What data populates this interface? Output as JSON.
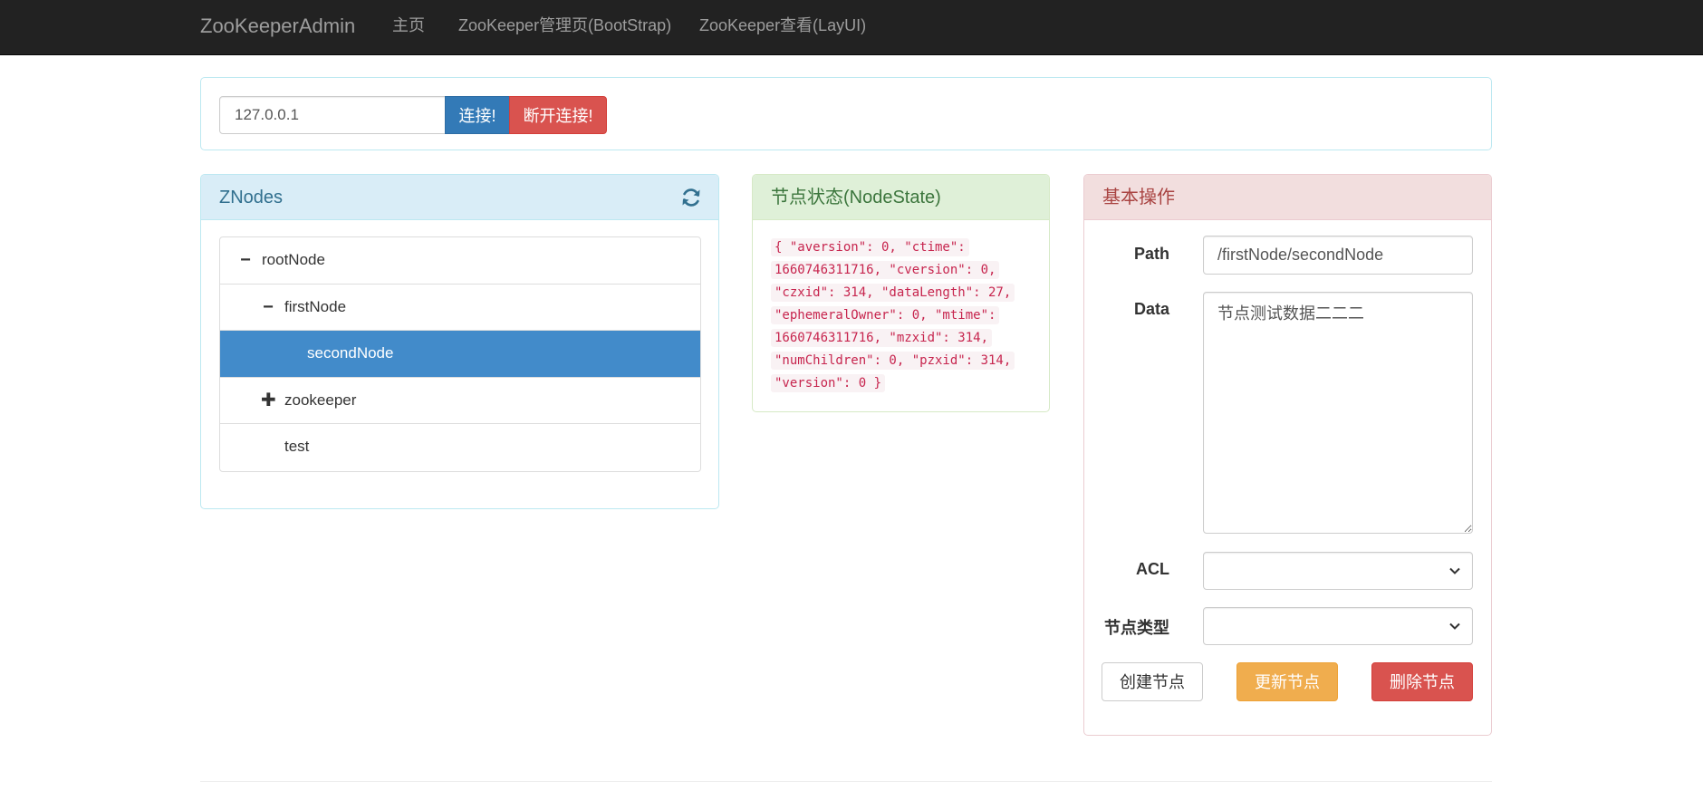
{
  "navbar": {
    "brand": "ZooKeeperAdmin",
    "links": [
      "主页",
      "ZooKeeper管理页(BootStrap)",
      "ZooKeeper查看(LayUI)"
    ]
  },
  "connect": {
    "host_value": "127.0.0.1",
    "connect_label": "连接!",
    "disconnect_label": "断开连接!"
  },
  "znodes": {
    "title": "ZNodes",
    "refresh_icon": "refresh-icon",
    "tree": [
      {
        "label": "rootNode",
        "level": 0,
        "icon": "minus",
        "selected": false
      },
      {
        "label": "firstNode",
        "level": 1,
        "icon": "minus",
        "selected": false
      },
      {
        "label": "secondNode",
        "level": 2,
        "icon": "",
        "selected": true
      },
      {
        "label": "zookeeper",
        "level": 1,
        "icon": "plus",
        "selected": false
      },
      {
        "label": "test",
        "level": 1,
        "icon": "",
        "selected": false
      }
    ]
  },
  "nodestate": {
    "title": "节点状态(NodeState)",
    "json_text": "{ \"aversion\": 0, \"ctime\": 1660746311716, \"cversion\": 0, \"czxid\": 314, \"dataLength\": 27, \"ephemeralOwner\": 0, \"mtime\": 1660746311716, \"mzxid\": 314, \"numChildren\": 0, \"pzxid\": 314, \"version\": 0 }"
  },
  "ops": {
    "title": "基本操作",
    "path_label": "Path",
    "path_value": "/firstNode/secondNode",
    "data_label": "Data",
    "data_value": "节点测试数据二二二",
    "acl_label": "ACL",
    "acl_value": "",
    "type_label": "节点类型",
    "type_value": "",
    "create_label": "创建节点",
    "update_label": "更新节点",
    "delete_label": "删除节点"
  },
  "colors": {
    "navbar_bg": "#222222",
    "primary": "#337ab7",
    "danger": "#d9534f",
    "warning": "#f0ad4e",
    "selected_node": "#428bca"
  }
}
